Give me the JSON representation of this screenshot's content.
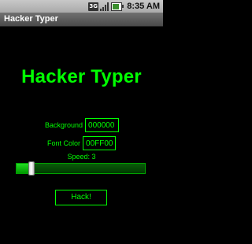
{
  "status_bar": {
    "network_label": "3G",
    "time": "8:35 AM",
    "battery_percent": 80
  },
  "title_bar": {
    "title": "Hacker Typer"
  },
  "main": {
    "heading": "Hacker Typer",
    "background_label": "Background",
    "background_value": "000000",
    "font_color_label": "Font Color",
    "font_color_value": "00FF00",
    "speed_label": "Speed: 3",
    "speed_fraction": 0.12,
    "hack_button_label": "Hack!"
  },
  "colors": {
    "accent": "#00ff00",
    "background": "#000000"
  }
}
